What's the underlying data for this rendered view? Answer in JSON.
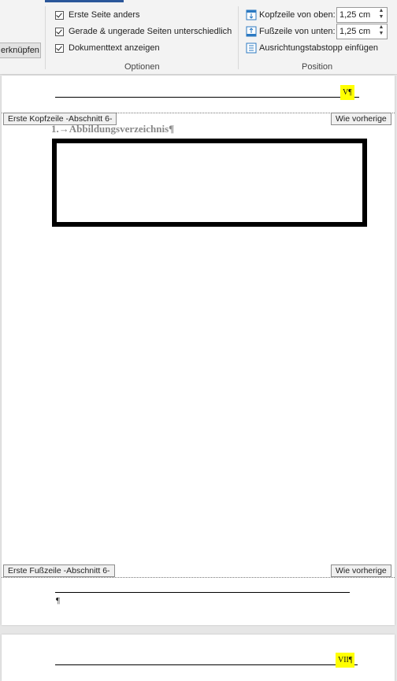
{
  "ribbon": {
    "link_button": "erknüpfen",
    "options": {
      "items": [
        {
          "label": "Erste Seite anders",
          "checked": true
        },
        {
          "label": "Gerade & ungerade Seiten unterschiedlich",
          "checked": true
        },
        {
          "label": "Dokumenttext anzeigen",
          "checked": true
        }
      ],
      "group_label": "Optionen"
    },
    "position": {
      "header_from_top_label": "Kopfzeile von oben:",
      "header_from_top_value": "1,25 cm",
      "footer_from_bottom_label": "Fußzeile von unten:",
      "footer_from_bottom_value": "1,25 cm",
      "insert_tab_label": "Ausrichtungstabstopp einfügen",
      "group_label": "Position"
    }
  },
  "page1": {
    "header_page_number": "V¶",
    "header_tag": "Erste Kopfzeile -Abschnitt 6-",
    "header_link_tag": "Wie vorherige",
    "heading": "1.→Abbildungsverzeichnis¶",
    "footer_tag": "Erste Fußzeile -Abschnitt 6-",
    "footer_link_tag": "Wie vorherige",
    "footer_pilcrow": "¶"
  },
  "page2": {
    "header_page_number": "VII¶"
  },
  "colors": {
    "highlight": "#ffff00",
    "ribbon_accent": "#2b579a"
  }
}
